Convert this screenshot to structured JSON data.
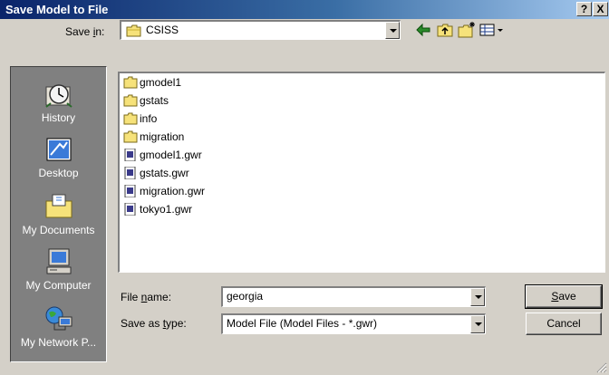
{
  "window": {
    "title": "Save Model to File",
    "help_button": "?",
    "close_button": "X"
  },
  "save_in": {
    "label_pre": "Save ",
    "label_mnemonic": "i",
    "label_post": "n:",
    "value": "CSISS"
  },
  "toolbar": {
    "icons": [
      "back-arrow-icon",
      "up-one-level-icon",
      "create-new-folder-icon",
      "view-menu-icon"
    ]
  },
  "places": [
    {
      "label": "History",
      "icon": "history-icon"
    },
    {
      "label": "Desktop",
      "icon": "desktop-icon"
    },
    {
      "label": "My Documents",
      "icon": "my-documents-icon"
    },
    {
      "label": "My Computer",
      "icon": "my-computer-icon"
    },
    {
      "label": "My Network P...",
      "icon": "my-network-places-icon"
    }
  ],
  "files": [
    {
      "name": "gmodel1",
      "type": "folder"
    },
    {
      "name": "gstats",
      "type": "folder"
    },
    {
      "name": "info",
      "type": "folder"
    },
    {
      "name": "migration",
      "type": "folder"
    },
    {
      "name": "gmodel1.gwr",
      "type": "file"
    },
    {
      "name": "gstats.gwr",
      "type": "file"
    },
    {
      "name": "migration.gwr",
      "type": "file"
    },
    {
      "name": "tokyo1.gwr",
      "type": "file"
    }
  ],
  "file_name": {
    "label_pre": "File ",
    "label_mnemonic": "n",
    "label_post": "ame:",
    "value": "georgia"
  },
  "save_as_type": {
    "label_pre": "Save as ",
    "label_mnemonic": "t",
    "label_post": "ype:",
    "value": "Model File (Model Files - *.gwr)"
  },
  "buttons": {
    "save_mnemonic": "S",
    "save_rest": "ave",
    "cancel": "Cancel"
  }
}
